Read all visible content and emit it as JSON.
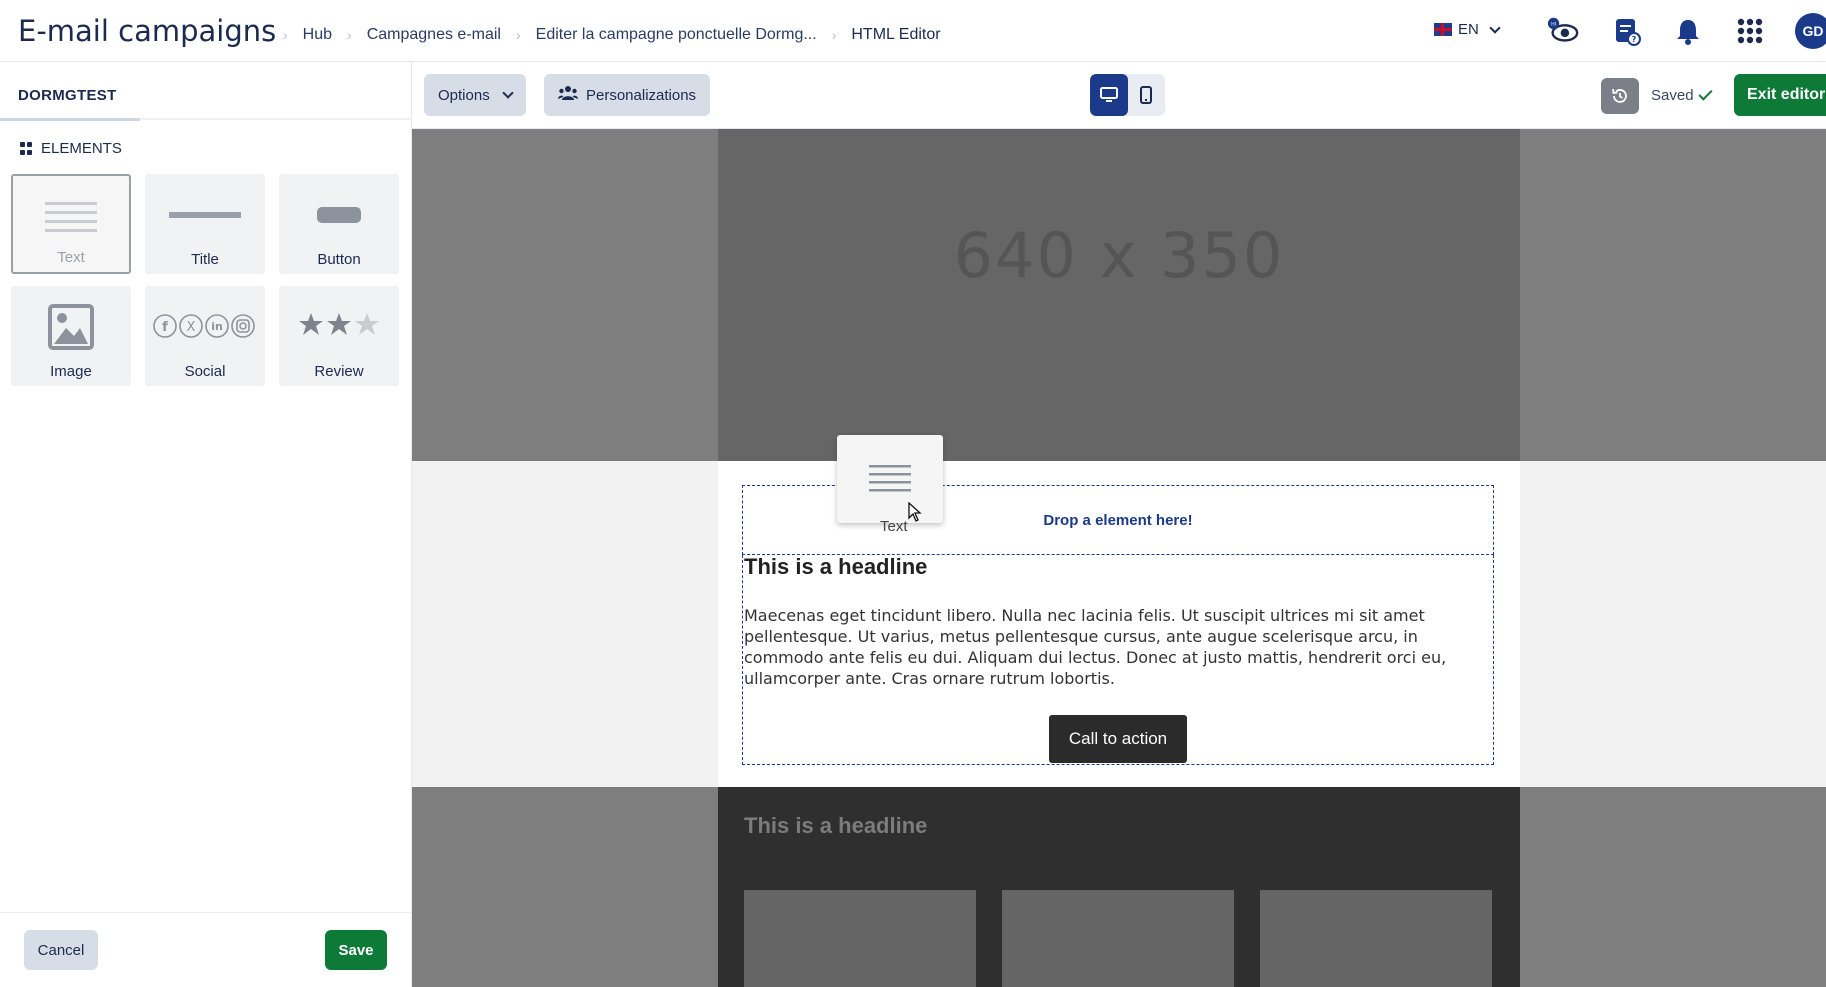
{
  "header": {
    "app_title": "E-mail campaigns",
    "breadcrumbs": [
      "Hub",
      "Campagnes e-mail",
      "Editer la campagne ponctuelle Dormg...",
      "HTML Editor"
    ],
    "language": "EN",
    "avatar_initials": "GD"
  },
  "left_panel": {
    "tab_label": "DORMGTEST",
    "elements_heading": "ELEMENTS",
    "elements": [
      {
        "label": "Text",
        "icon": "text-lines-icon",
        "selected": true
      },
      {
        "label": "Title",
        "icon": "title-bar-icon"
      },
      {
        "label": "Button",
        "icon": "button-shape-icon"
      },
      {
        "label": "Image",
        "icon": "image-icon"
      },
      {
        "label": "Social",
        "icon": "social-icons"
      },
      {
        "label": "Review",
        "icon": "stars-icon"
      }
    ],
    "cancel_label": "Cancel",
    "save_label": "Save"
  },
  "toolbar": {
    "options_label": "Options",
    "personalizations_label": "Personalizations",
    "saved_label": "Saved",
    "exit_label": "Exit editor"
  },
  "canvas": {
    "hero_placeholder": "640 x 350",
    "drop_zone_text": "Drop a element here!",
    "headline": "This is a headline",
    "body": "Maecenas eget tincidunt libero. Nulla nec lacinia felis. Ut suscipit ultrices mi sit amet pellentesque. Ut varius, metus pellentesque cursus, ante augue scelerisque arcu, in commodo ante felis eu dui. Aliquam dui lectus. Donec at justo mattis, hendrerit orci eu, ullamcorper ante. Cras ornare rutrum lobortis.",
    "cta_label": "Call to action",
    "dark_headline": "This is a headline"
  },
  "drag_ghost": {
    "label": "Text"
  },
  "colors": {
    "primary": "#1b3a8a",
    "success": "#0e7a38",
    "secondary_button": "#d7dde6"
  }
}
